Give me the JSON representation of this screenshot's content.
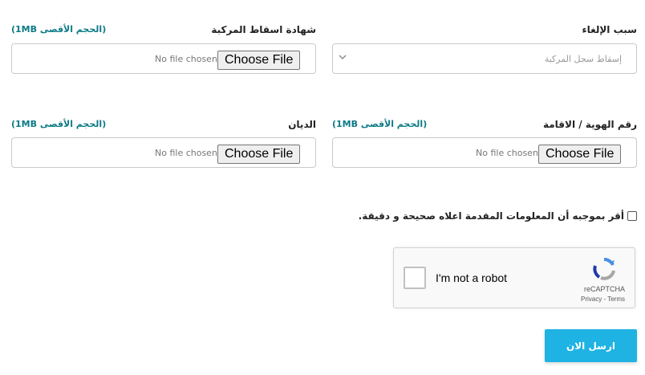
{
  "row1": {
    "cancel_reason": {
      "label": "سبب الإلغاء",
      "selected": "إسقاط سجل المركبة"
    },
    "vehicle_drop_cert": {
      "label": "شهادة اسقاط المركبة",
      "hint": "(الحجم الأقصى 1MB)",
      "button": "Choose File",
      "status": "No file chosen"
    }
  },
  "row2": {
    "id_residency": {
      "label": "رقم الهوية / الاقامة",
      "hint": "(الحجم الأقصى 1MB)",
      "button": "Choose File",
      "status": "No file chosen"
    },
    "diyan": {
      "label": "الديان",
      "hint": "(الحجم الأقصى 1MB)",
      "button": "Choose File",
      "status": "No file chosen"
    }
  },
  "declaration": {
    "text": "أقر بموجبه أن المعلومات المقدمة اعلاه صحيحة و دقيقة."
  },
  "recaptcha": {
    "label": "I'm not a robot",
    "brand": "reCAPTCHA",
    "privacy": "Privacy",
    "separator": " - ",
    "terms": "Terms"
  },
  "submit_label": "ارسل الان",
  "colors": {
    "accent": "#1eb3e3",
    "hint": "#0c7a86"
  }
}
